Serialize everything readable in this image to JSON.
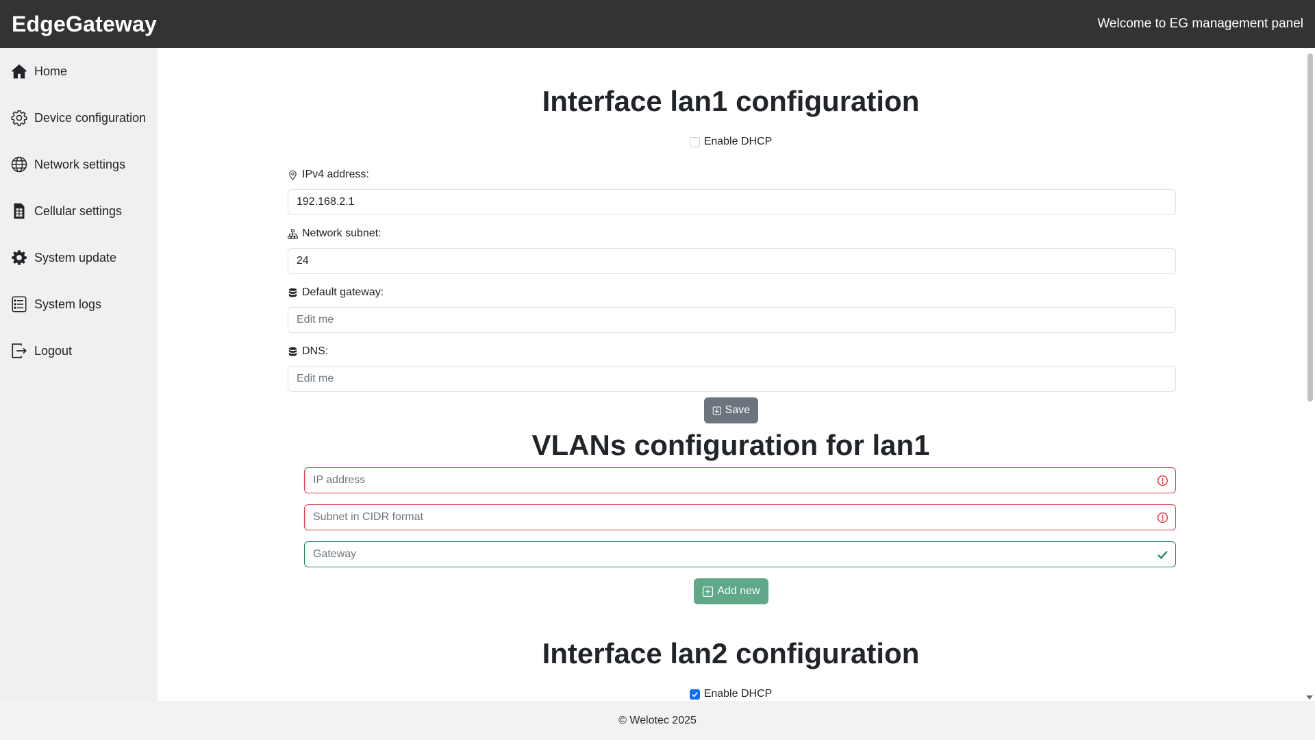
{
  "header": {
    "brand": "EdgeGateway",
    "welcome": "Welcome to EG management panel"
  },
  "sidebar": {
    "items": [
      {
        "label": "Home",
        "icon": "house-icon"
      },
      {
        "label": "Device configuration",
        "icon": "gear-icon"
      },
      {
        "label": "Network settings",
        "icon": "globe-icon"
      },
      {
        "label": "Cellular settings",
        "icon": "sim-icon"
      },
      {
        "label": "System update",
        "icon": "gear-fill-icon"
      },
      {
        "label": "System logs",
        "icon": "list-icon"
      },
      {
        "label": "Logout",
        "icon": "logout-icon"
      }
    ]
  },
  "lan1": {
    "title": "Interface lan1 configuration",
    "dhcp_label": "Enable DHCP",
    "dhcp_checked": false,
    "ipv4_label": "IPv4 address:",
    "ipv4_value": "192.168.2.1",
    "subnet_label": "Network subnet:",
    "subnet_value": "24",
    "gateway_label": "Default gateway:",
    "gateway_placeholder": "Edit me",
    "dns_label": "DNS:",
    "dns_placeholder": "Edit me",
    "save_label": "Save"
  },
  "vlans": {
    "title": "VLANs configuration for lan1",
    "ip_placeholder": "IP address",
    "subnet_placeholder": "Subnet in CIDR format",
    "gateway_placeholder": "Gateway",
    "add_label": "Add new",
    "colors": {
      "error": "#dc3545",
      "valid": "#198754"
    }
  },
  "lan2": {
    "title": "Interface lan2 configuration",
    "dhcp_label": "Enable DHCP",
    "dhcp_checked": true
  },
  "footer": {
    "text": "© Welotec 2025"
  },
  "colors": {
    "topbar": "#333333",
    "sidebar": "#f0f0f0",
    "save_button": "#6c757d",
    "add_button": "#5fa889",
    "checkbox_checked": "#0d6efd"
  }
}
